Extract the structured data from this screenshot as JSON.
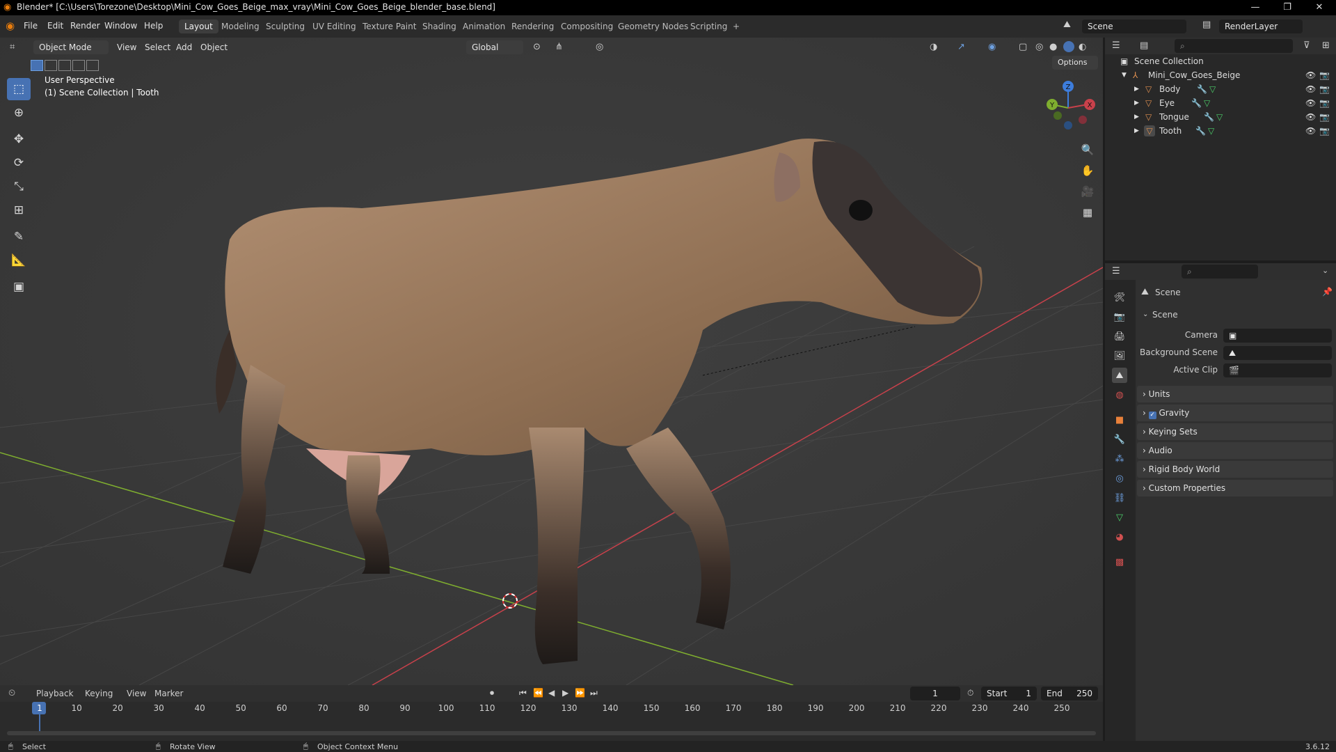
{
  "window": {
    "title": "Blender* [C:\\Users\\Torezone\\Desktop\\Mini_Cow_Goes_Beige_max_vray\\Mini_Cow_Goes_Beige_blender_base.blend]",
    "controls": [
      "—",
      "❐",
      "✕"
    ]
  },
  "menu": [
    "File",
    "Edit",
    "Render",
    "Window",
    "Help"
  ],
  "workspaces": [
    "Layout",
    "Modeling",
    "Sculpting",
    "UV Editing",
    "Texture Paint",
    "Shading",
    "Animation",
    "Rendering",
    "Compositing",
    "Geometry Nodes",
    "Scripting"
  ],
  "active_workspace": "Layout",
  "add_workspace": "+",
  "scene_field": "Scene",
  "renderlayer_field": "RenderLayer",
  "viewport": {
    "mode": "Object Mode",
    "menus": [
      "View",
      "Select",
      "Add",
      "Object"
    ],
    "orientation": "Global",
    "options": "Options",
    "perspective_label": "User Perspective",
    "collection_label": "(1) Scene Collection | Tooth",
    "gizmo_axes": [
      "Z",
      "Y",
      "X"
    ]
  },
  "toolbar_icons": [
    "select-box-icon",
    "cursor-icon",
    "move-icon",
    "rotate-icon",
    "scale-icon",
    "transform-icon",
    "annotate-icon",
    "measure-icon",
    "add-cube-icon"
  ],
  "outliner": {
    "root": "Scene Collection",
    "collection": "Mini_Cow_Goes_Beige",
    "objects": [
      "Body",
      "Eye",
      "Tongue",
      "Tooth"
    ]
  },
  "properties": {
    "header": "Scene",
    "panel": "Scene",
    "camera_label": "Camera",
    "background_label": "Background Scene",
    "clip_label": "Active Clip",
    "panels": [
      "Units",
      "Gravity",
      "Keying Sets",
      "Audio",
      "Rigid Body World",
      "Custom Properties"
    ],
    "gravity_checked": true
  },
  "timeline": {
    "menus": [
      "Playback",
      "Keying",
      "View",
      "Marker"
    ],
    "current_frame": "1",
    "start_label": "Start",
    "start": "1",
    "end_label": "End",
    "end": "250",
    "ticks": [
      "1",
      "10",
      "20",
      "30",
      "40",
      "50",
      "60",
      "70",
      "80",
      "90",
      "100",
      "110",
      "120",
      "130",
      "140",
      "150",
      "160",
      "170",
      "180",
      "190",
      "200",
      "210",
      "220",
      "230",
      "240",
      "250"
    ]
  },
  "status": {
    "select": "Select",
    "rotate": "Rotate View",
    "context": "Object Context Menu",
    "version": "3.6.12"
  },
  "colors": {
    "accent": "#4772b3",
    "x_axis": "#c8414b",
    "y_axis": "#7fae2f",
    "z_axis": "#3d7ddc"
  }
}
